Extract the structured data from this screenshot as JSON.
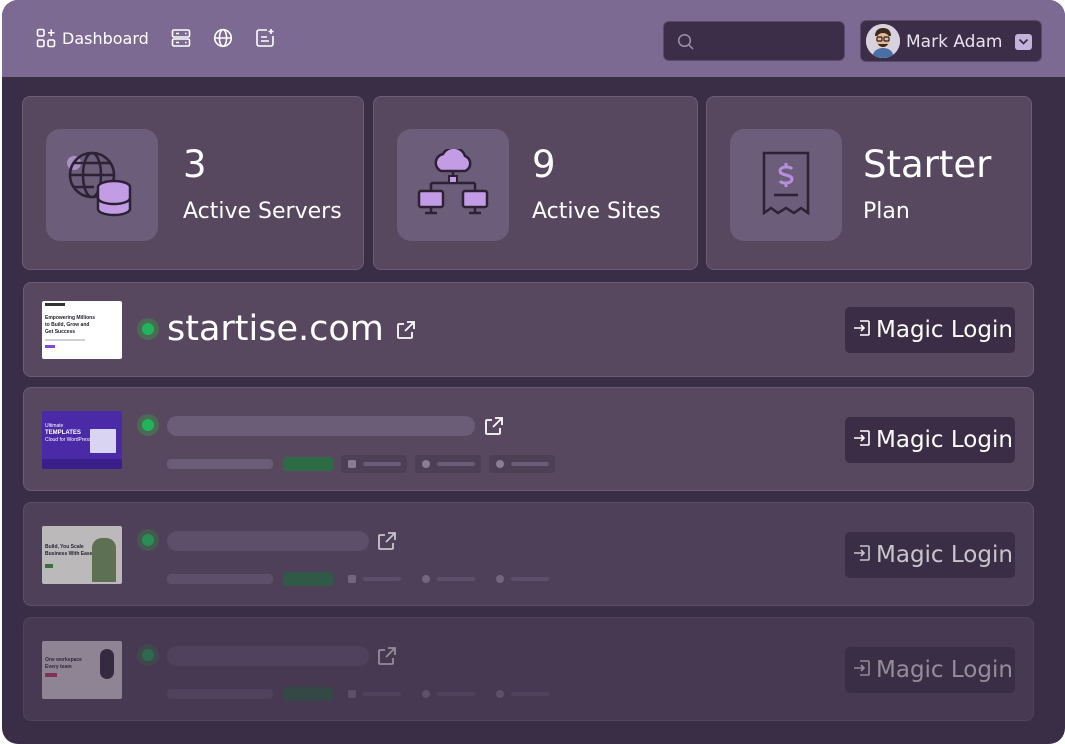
{
  "nav": {
    "dashboard_label": "Dashboard",
    "icons": [
      "dashboard-icon",
      "servers-icon",
      "globe-icon",
      "notes-icon"
    ]
  },
  "search": {
    "placeholder": ""
  },
  "user": {
    "name": "Mark Adam"
  },
  "stats": [
    {
      "value": "3",
      "label": "Active Servers",
      "icon": "globe-database-icon"
    },
    {
      "value": "9",
      "label": "Active Sites",
      "icon": "cloud-network-icon"
    },
    {
      "value": "Starter",
      "label": "Plan",
      "icon": "invoice-dollar-icon"
    }
  ],
  "sites": [
    {
      "name": "startise.com",
      "status": "active",
      "thumbnail_text": [
        "Empowering Millions",
        "to Build, Grow and",
        "Get Success"
      ],
      "button_label": "Magic Login"
    },
    {
      "name": "",
      "status": "active",
      "thumbnail_text": [
        "Ultimate",
        "TEMPLATES",
        "Cloud for WordPress"
      ],
      "button_label": "Magic Login"
    },
    {
      "name": "",
      "status": "active",
      "thumbnail_text": [
        "Build, You Scale",
        "Business With Ease"
      ],
      "button_label": "Magic Login"
    },
    {
      "name": "",
      "status": "active",
      "thumbnail_text": [
        "One workspace",
        "Every team"
      ],
      "button_label": "Magic Login"
    }
  ],
  "colors": {
    "topbar": "#7d6a93",
    "background": "#3a2d46",
    "card": "#57485f",
    "status_green": "#21b45a"
  }
}
